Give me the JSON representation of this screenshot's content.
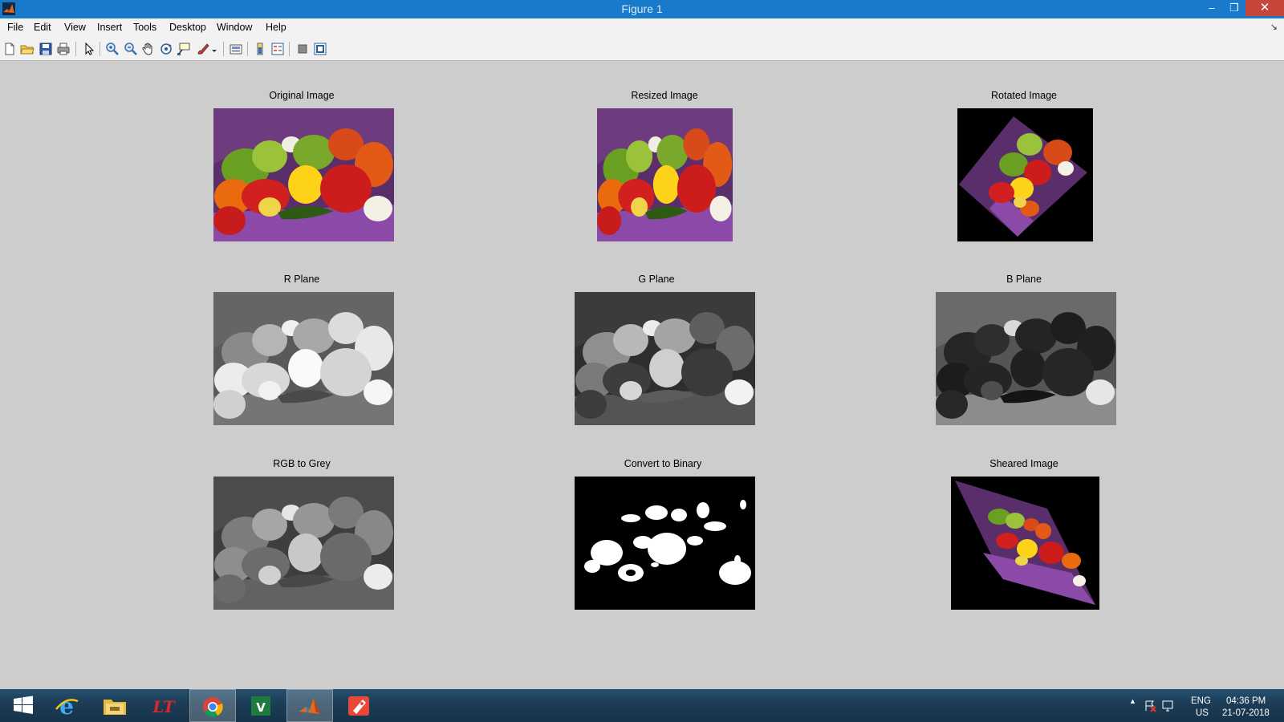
{
  "window": {
    "title": "Figure 1",
    "min_glyph": "–",
    "max_glyph": "❐",
    "close_glyph": "✕"
  },
  "menu": {
    "items": [
      "File",
      "Edit",
      "View",
      "Insert",
      "Tools",
      "Desktop",
      "Window",
      "Help"
    ],
    "dock_glyph": "↘"
  },
  "toolbar": {
    "buttons": [
      "new-figure",
      "open-file",
      "save-figure",
      "print-figure",
      "edit-plot",
      "zoom-in",
      "zoom-out",
      "pan",
      "rotate-3d",
      "data-cursor",
      "brush",
      "link-plot",
      "insert-colorbar",
      "insert-legend",
      "hide-plot-tools",
      "show-plot-tools"
    ]
  },
  "subplots": [
    {
      "title": "Original Image"
    },
    {
      "title": "Resized Image"
    },
    {
      "title": "Rotated Image"
    },
    {
      "title": "R Plane"
    },
    {
      "title": "G Plane"
    },
    {
      "title": "B Plane"
    },
    {
      "title": "RGB to Grey"
    },
    {
      "title": "Convert to Binary"
    },
    {
      "title": "Sheared Image"
    }
  ],
  "taskbar": {
    "apps": [
      "start",
      "internet-explorer",
      "file-explorer",
      "app-red",
      "chrome",
      "vs-app",
      "matlab",
      "app-rocket"
    ],
    "active_app": "matlab",
    "lang_top": "ENG",
    "lang_bottom": "US",
    "time": "04:36 PM",
    "date": "21-07-2018"
  },
  "colors": {
    "titlebar": "#1979ca",
    "figure_bg": "#cdcdcd",
    "close_button": "#c7463b"
  }
}
